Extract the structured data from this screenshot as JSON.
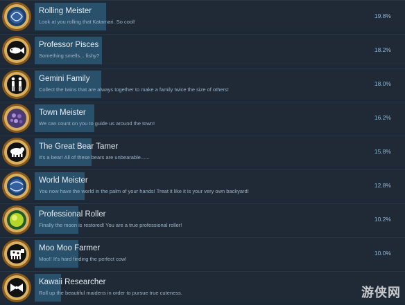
{
  "colors": {
    "background": "#1b2838",
    "row": "#202a36",
    "bar": "#2b5876",
    "percent": "#8fb9d9"
  },
  "achievements": [
    {
      "title": "Rolling Meister",
      "description": "Look at you rolling that Katamari. So cool!",
      "percent": "19.8%",
      "ratio": 0.198,
      "icon": "katamari-galaxy-icon"
    },
    {
      "title": "Professor Pisces",
      "description": "Something smells... fishy?",
      "percent": "18.2%",
      "ratio": 0.182,
      "icon": "fish-icon"
    },
    {
      "title": "Gemini Family",
      "description": "Collect the twins that are always together to make a family twice the size of others!",
      "percent": "18.0%",
      "ratio": 0.18,
      "icon": "twins-icon"
    },
    {
      "title": "Town Meister",
      "description": "We can count on you to guide us around the town!",
      "percent": "16.2%",
      "ratio": 0.162,
      "icon": "town-ball-icon"
    },
    {
      "title": "The Great Bear Tamer",
      "description": "It's a bear! All of these bears are unbearable......",
      "percent": "15.8%",
      "ratio": 0.158,
      "icon": "bear-icon"
    },
    {
      "title": "World Meister",
      "description": "You now have the world in the palm of your hands! Treat it like it is your very own backyard!",
      "percent": "12.8%",
      "ratio": 0.128,
      "icon": "world-ball-icon"
    },
    {
      "title": "Professional Roller",
      "description": "Finally the moon is restored! You are a true professional roller!",
      "percent": "10.2%",
      "ratio": 0.102,
      "icon": "moon-icon"
    },
    {
      "title": "Moo Moo Farmer",
      "description": "Moo!! It's hard finding the perfect cow!",
      "percent": "10.0%",
      "ratio": 0.1,
      "icon": "cow-icon"
    },
    {
      "title": "Kawaii Researcher",
      "description": "Roll up the beautiful maidens in order to pursue true cuteness.",
      "percent": "",
      "ratio": 0.07,
      "icon": "bow-icon"
    }
  ],
  "watermark": "游侠网"
}
